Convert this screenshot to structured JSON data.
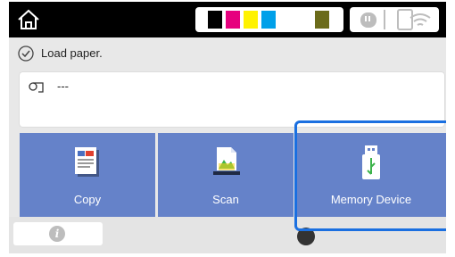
{
  "status_bar": {
    "home_icon": "home-icon",
    "ink_colors": [
      "#000000",
      "#e6007e",
      "#fff200",
      "#00a0e9",
      "#6b6b1a"
    ],
    "network_icons": [
      "wired-lan-icon",
      "wifi-icon"
    ]
  },
  "message": {
    "icon": "check-circle-icon",
    "text": "Load paper."
  },
  "paper": {
    "icon": "paper-roll-icon",
    "text": "---"
  },
  "tiles": [
    {
      "label": "Copy",
      "icon": "copy-icon"
    },
    {
      "label": "Scan",
      "icon": "scan-icon"
    },
    {
      "label": "Memory Device",
      "icon": "usb-memory-icon"
    }
  ],
  "bottom": {
    "info_icon": "info-icon",
    "info_glyph": "i"
  },
  "colors": {
    "tile_blue": "#6582c9",
    "highlight_blue": "#1a6fe0"
  }
}
